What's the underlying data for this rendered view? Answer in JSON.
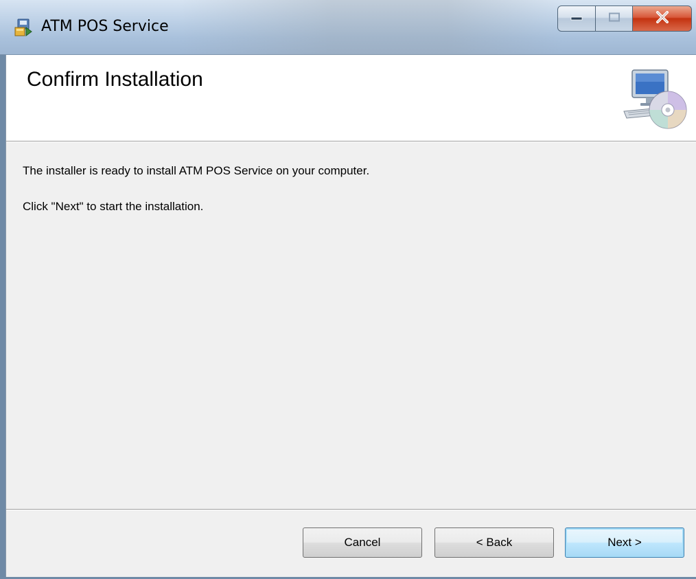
{
  "window": {
    "title": "ATM POS Service",
    "icons": {
      "app": "installer-package-icon",
      "minimize": "minimize-icon",
      "maximize": "maximize-icon",
      "close": "close-icon"
    }
  },
  "header": {
    "title": "Confirm Installation",
    "icon": "computer-cd-icon"
  },
  "body": {
    "line1": "The installer is ready to install ATM POS Service on your computer.",
    "line2": "Click \"Next\" to start the installation."
  },
  "buttons": {
    "cancel": "Cancel",
    "back": "< Back",
    "next": "Next >"
  },
  "colors": {
    "close_button": "#c43310",
    "default_button_border": "#3c7fb1",
    "client_background": "#f0f0f0"
  }
}
